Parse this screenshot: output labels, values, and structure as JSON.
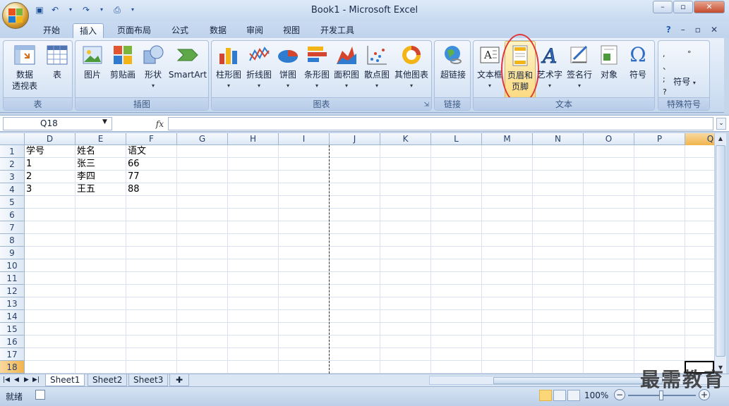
{
  "window": {
    "title": "Book1 - Microsoft Excel",
    "minimize": "–",
    "restore": "▫",
    "close": "✕"
  },
  "tabs": [
    "开始",
    "插入",
    "页面布局",
    "公式",
    "数据",
    "审阅",
    "视图",
    "开发工具"
  ],
  "active_tab": "插入",
  "tabs_right": {
    "help": "?",
    "min": "–",
    "restore": "▫",
    "close": "✕"
  },
  "ribbon": {
    "groups": [
      {
        "label": "表",
        "buttons": [
          {
            "label": "数据\n透视表"
          },
          {
            "label": "表"
          }
        ]
      },
      {
        "label": "插图",
        "buttons": [
          {
            "label": "图片"
          },
          {
            "label": "剪贴画"
          },
          {
            "label": "形状"
          },
          {
            "label": "SmartArt"
          }
        ]
      },
      {
        "label": "图表",
        "buttons": [
          {
            "label": "柱形图"
          },
          {
            "label": "折线图"
          },
          {
            "label": "饼图"
          },
          {
            "label": "条形图"
          },
          {
            "label": "面积图"
          },
          {
            "label": "散点图"
          },
          {
            "label": "其他图表"
          }
        ]
      },
      {
        "label": "链接",
        "buttons": [
          {
            "label": "超链接"
          }
        ]
      },
      {
        "label": "文本",
        "buttons": [
          {
            "label": "文本框"
          },
          {
            "label": "页眉和\n页脚"
          },
          {
            "label": "艺术字"
          },
          {
            "label": "签名行"
          },
          {
            "label": "对象"
          },
          {
            "label": "符号"
          }
        ]
      },
      {
        "label": "特殊符号",
        "buttons": [
          {
            "label": "符号"
          }
        ]
      }
    ],
    "highlight_color": "#e0383a"
  },
  "namebox": {
    "value": "Q18"
  },
  "formula": {
    "fx": "fx",
    "value": ""
  },
  "columns": [
    "D",
    "E",
    "F",
    "G",
    "H",
    "I",
    "J",
    "K",
    "L",
    "M",
    "N",
    "O",
    "P",
    "Q"
  ],
  "rows": [
    "1",
    "2",
    "3",
    "4",
    "5",
    "6",
    "7",
    "8",
    "9",
    "10",
    "11",
    "12",
    "13",
    "14",
    "15",
    "16",
    "17",
    "18"
  ],
  "cells": [
    [
      "学号",
      "姓名",
      "语文"
    ],
    [
      "1",
      "张三",
      "66"
    ],
    [
      "2",
      "李四",
      "77"
    ],
    [
      "3",
      "王五",
      "88"
    ]
  ],
  "sheets": [
    "Sheet1",
    "Sheet2",
    "Sheet3"
  ],
  "active_sheet": "Sheet1",
  "status": {
    "ready": "就绪",
    "zoom": "100%"
  },
  "watermark": "最需教育"
}
